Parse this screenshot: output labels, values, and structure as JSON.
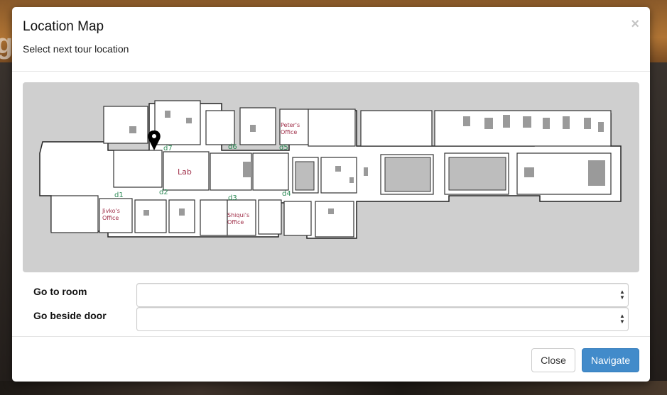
{
  "modal": {
    "title": "Location Map",
    "subtitle": "Select next tour location",
    "close_symbol": "×"
  },
  "map": {
    "room_labels": {
      "lab": "Lab",
      "peters_office": [
        "Peter's",
        "Office"
      ],
      "jivkos_office": [
        "Jivko's",
        "Office"
      ],
      "shiquis_office": [
        "Shiqui's",
        "Office"
      ]
    },
    "door_labels": [
      "d1",
      "d2",
      "d3",
      "d4",
      "d5",
      "d6",
      "d7"
    ],
    "marker_icon": "map-pin-icon",
    "colors": {
      "door_label": "#2e8b57",
      "room_label": "#a0304a",
      "background": "#cfcfcf"
    }
  },
  "form": {
    "room_label": "Go to room",
    "room_value": "",
    "door_label": "Go beside door",
    "door_value": ""
  },
  "footer": {
    "close_label": "Close",
    "navigate_label": "Navigate"
  },
  "colors": {
    "primary": "#428bca"
  }
}
